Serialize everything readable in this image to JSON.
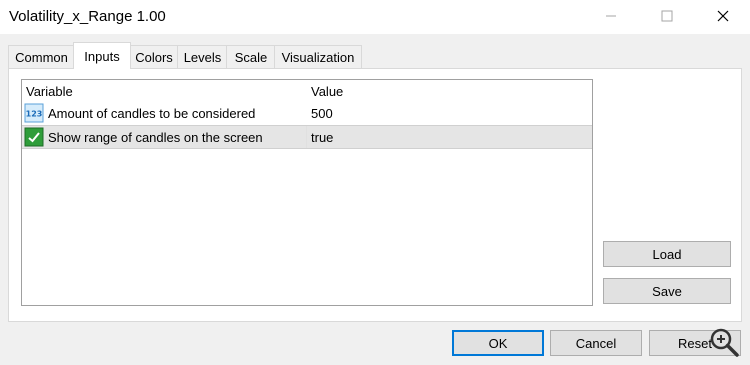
{
  "window": {
    "title": "Volatility_x_Range 1.00",
    "minimize_icon": "minimize-icon",
    "maximize_icon": "maximize-icon",
    "close_icon": "close-icon"
  },
  "tabs": [
    {
      "label": "Common",
      "active": false
    },
    {
      "label": "Inputs",
      "active": true
    },
    {
      "label": "Colors",
      "active": false
    },
    {
      "label": "Levels",
      "active": false
    },
    {
      "label": "Scale",
      "active": false
    },
    {
      "label": "Visualization",
      "active": false
    }
  ],
  "grid": {
    "columns": [
      "Variable",
      "Value"
    ],
    "rows": [
      {
        "icon": "integer-icon",
        "variable": "Amount of candles to be considered",
        "value": "500"
      },
      {
        "icon": "boolean-icon",
        "variable": "Show range of candles on the screen",
        "value": "true"
      }
    ]
  },
  "side_buttons": {
    "load": "Load",
    "save": "Save"
  },
  "footer_buttons": {
    "ok": "OK",
    "cancel": "Cancel",
    "reset": "Reset"
  },
  "colors": {
    "accent": "#0078d7",
    "selected_row": "#e5e5e5"
  }
}
